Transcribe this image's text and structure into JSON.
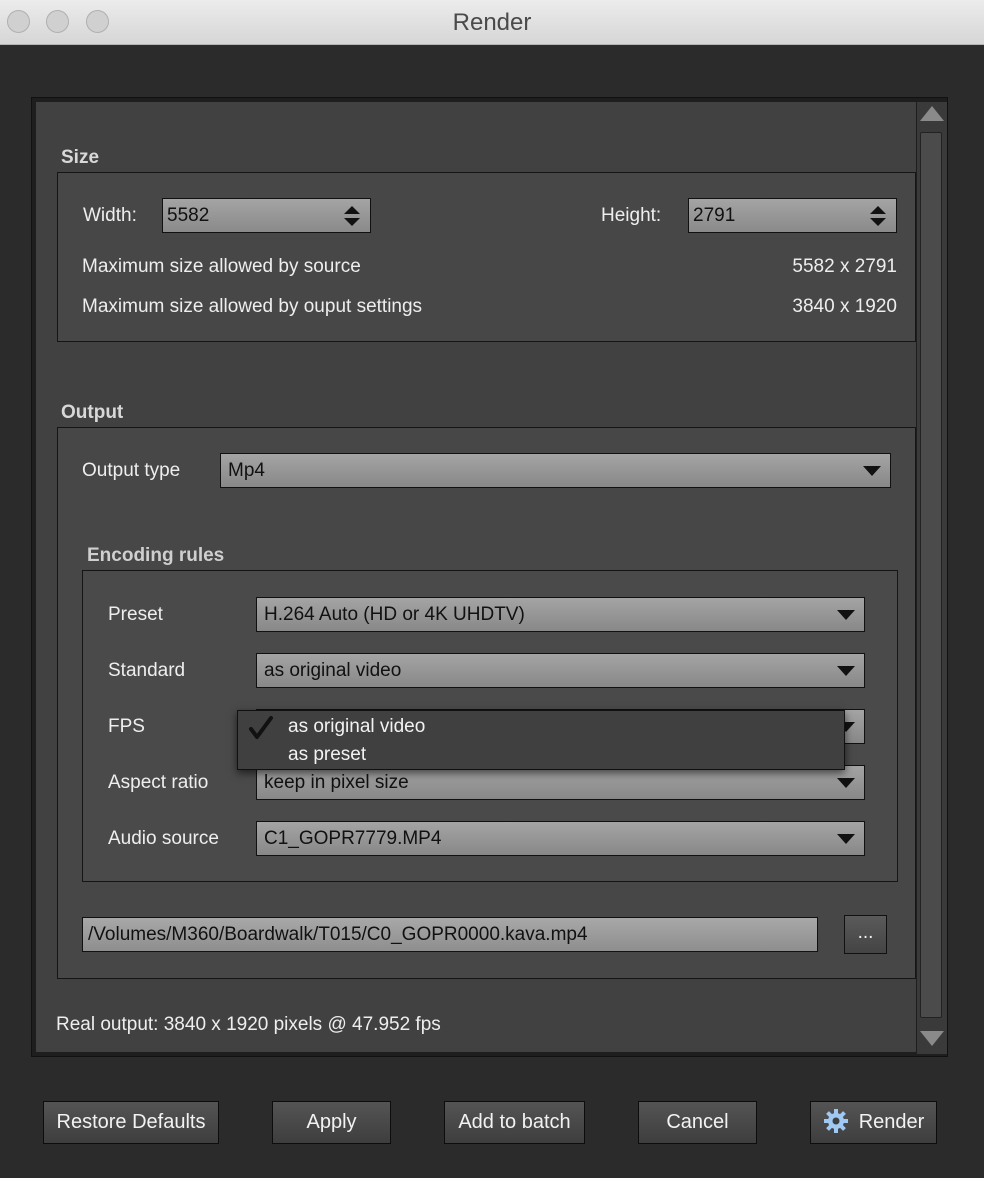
{
  "window": {
    "title": "Render"
  },
  "size": {
    "section_title": "Size",
    "width_label": "Width:",
    "width_value": "5582",
    "height_label": "Height:",
    "height_value": "2791",
    "max_source_label": "Maximum size allowed by source",
    "max_source_value": "5582 x 2791",
    "max_output_label": "Maximum size allowed by ouput settings",
    "max_output_value": "3840 x 1920"
  },
  "output": {
    "section_title": "Output",
    "output_type_label": "Output type",
    "output_type_value": "Mp4",
    "encoding": {
      "title": "Encoding rules",
      "preset_label": "Preset",
      "preset_value": "H.264 Auto (HD or 4K UHDTV)",
      "standard_label": "Standard",
      "standard_value": "as original video",
      "fps_label": "FPS",
      "aspect_label": "Aspect ratio",
      "aspect_value": "keep in pixel size",
      "audio_label": "Audio source",
      "audio_value": "C1_GOPR7779.MP4"
    },
    "path": "/Volumes/M360/Boardwalk/T015/C0_GOPR0000.kava.mp4",
    "browse_label": "..."
  },
  "fps_menu": {
    "options": [
      "as original video",
      "as preset"
    ],
    "selected": "as original video"
  },
  "real_output": "Real output: 3840 x 1920 pixels @ 47.952 fps",
  "buttons": {
    "restore": "Restore Defaults",
    "apply": "Apply",
    "add_batch": "Add to batch",
    "cancel": "Cancel",
    "render": "Render"
  },
  "icons": {
    "render_icon": "gear-icon",
    "checkmark": "checkmark-icon"
  }
}
